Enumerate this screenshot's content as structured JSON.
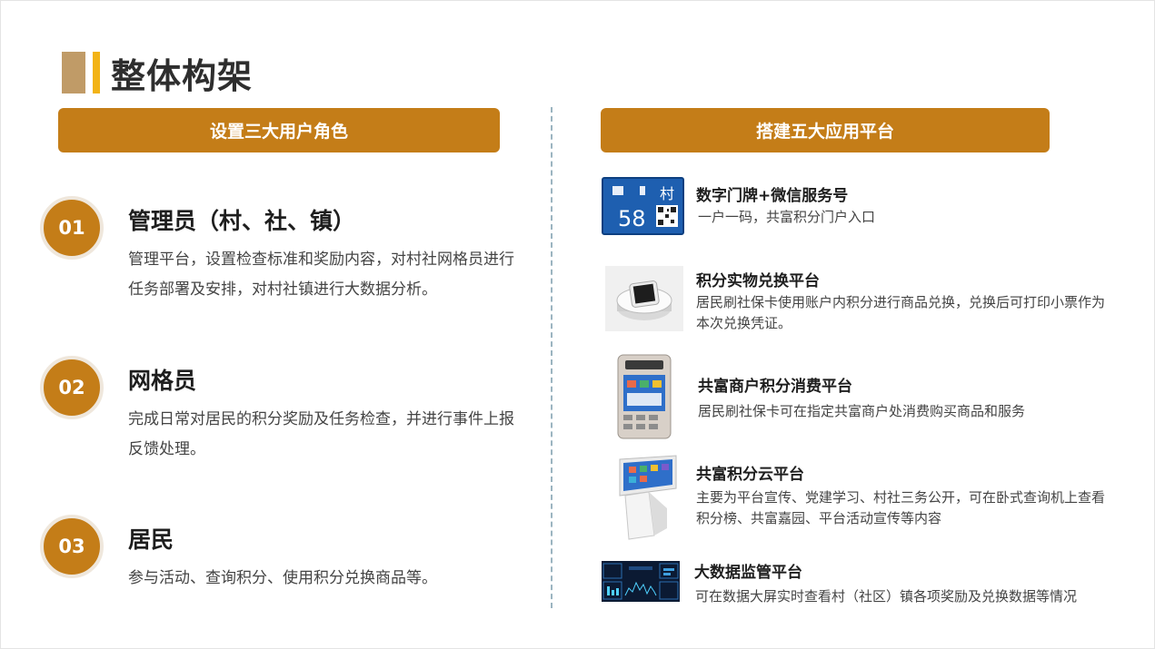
{
  "header": {
    "title": "整体构架"
  },
  "left_banner": "设置三大用户角色",
  "right_banner": "搭建五大应用平台",
  "roles": [
    {
      "num": "01",
      "title": "管理员（村、社、镇）",
      "desc": "管理平台，设置检查标准和奖励内容，对村社网格员进行任务部署及安排，对村社镇进行大数据分析。"
    },
    {
      "num": "02",
      "title": "网格员",
      "desc": "完成日常对居民的积分奖励及任务检查，并进行事件上报反馈处理。"
    },
    {
      "num": "03",
      "title": "居民",
      "desc": "参与活动、查询积分、使用积分兑换商品等。"
    }
  ],
  "apps": [
    {
      "title": "数字门牌+微信服务号",
      "desc": "一户一码，共富积分门户入口",
      "icon": "door-plate-image",
      "plate_text": "村",
      "plate_num": "58"
    },
    {
      "title": "积分实物兑换平台",
      "desc": "居民刷社保卡使用账户内积分进行商品兑换，兑换后可打印小票作为本次兑换凭证。",
      "icon": "redemption-machine-image"
    },
    {
      "title": "共富商户积分消费平台",
      "desc": "居民刷社保卡可在指定共富商户处消费购买商品和服务",
      "icon": "pos-terminal-image"
    },
    {
      "title": "共富积分云平台",
      "desc": "主要为平台宣传、党建学习、村社三务公开，可在卧式查询机上查看积分榜、共富嘉园、平台活动宣传等内容",
      "icon": "kiosk-image"
    },
    {
      "title": "大数据监管平台",
      "desc": "可在数据大屏实时查看村（社区）镇各项奖励及兑换数据等情况",
      "icon": "dashboard-screen-image"
    }
  ],
  "colors": {
    "accent": "#c47d18",
    "title_bar_light": "#c09b67",
    "title_bar_yellow": "#f2b316",
    "divider": "#9bb4c0"
  }
}
